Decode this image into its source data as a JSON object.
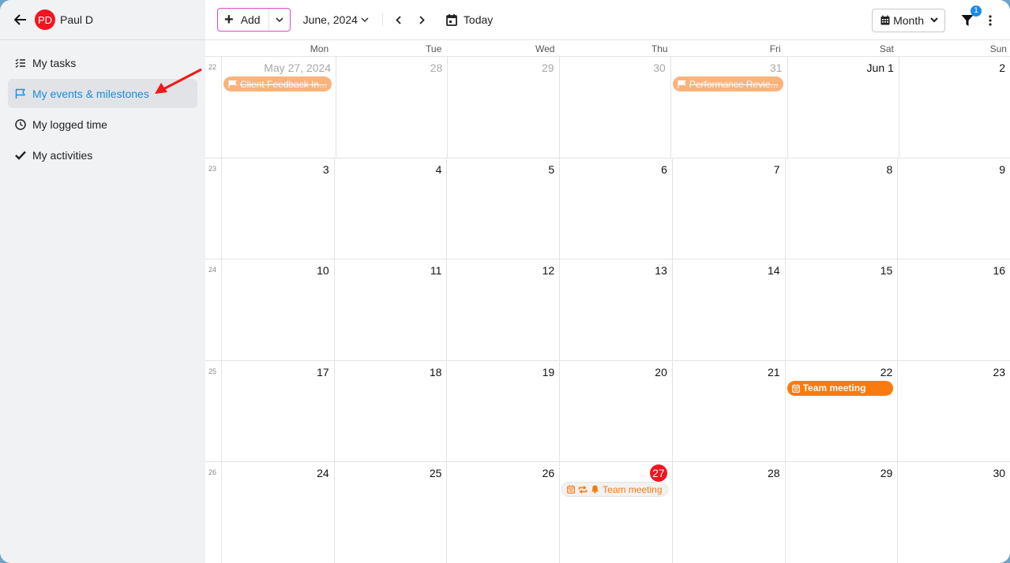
{
  "sidebar": {
    "user": {
      "initials": "PD",
      "name": "Paul D",
      "avatar_color": "#f5141f"
    },
    "items": [
      {
        "label": "My tasks",
        "icon": "checklist-icon",
        "active": false
      },
      {
        "label": "My events & milestones",
        "icon": "flag-icon",
        "active": true
      },
      {
        "label": "My logged time",
        "icon": "clock-icon",
        "active": false
      },
      {
        "label": "My activities",
        "icon": "check-icon",
        "active": false
      }
    ]
  },
  "toolbar": {
    "add_label": "Add",
    "period_label": "June, 2024",
    "today_label": "Today",
    "view_label": "Month",
    "filter_count": "1"
  },
  "calendar": {
    "days_of_week": [
      "Mon",
      "Tue",
      "Wed",
      "Thu",
      "Fri",
      "Sat",
      "Sun"
    ],
    "weeks": [
      {
        "number": "22",
        "days": [
          {
            "label": "May 27, 2024",
            "other": true,
            "events": [
              {
                "title": "Client Feedback In...",
                "style": "done",
                "icons": [
                  "flag-icon"
                ]
              }
            ]
          },
          {
            "label": "28",
            "other": true
          },
          {
            "label": "29",
            "other": true
          },
          {
            "label": "30",
            "other": true
          },
          {
            "label": "31",
            "other": true,
            "events": [
              {
                "title": "Performance Revie...",
                "style": "done",
                "icons": [
                  "flag-icon"
                ]
              }
            ]
          },
          {
            "label": "Jun 1"
          },
          {
            "label": "2"
          }
        ]
      },
      {
        "number": "23",
        "days": [
          {
            "label": "3"
          },
          {
            "label": "4"
          },
          {
            "label": "5"
          },
          {
            "label": "6"
          },
          {
            "label": "7"
          },
          {
            "label": "8"
          },
          {
            "label": "9"
          }
        ]
      },
      {
        "number": "24",
        "days": [
          {
            "label": "10"
          },
          {
            "label": "11"
          },
          {
            "label": "12"
          },
          {
            "label": "13"
          },
          {
            "label": "14"
          },
          {
            "label": "15"
          },
          {
            "label": "16"
          }
        ]
      },
      {
        "number": "25",
        "days": [
          {
            "label": "17"
          },
          {
            "label": "18"
          },
          {
            "label": "19"
          },
          {
            "label": "20"
          },
          {
            "label": "21"
          },
          {
            "label": "22",
            "events": [
              {
                "title": "Team meeting",
                "style": "solid",
                "icons": [
                  "calendar-icon"
                ]
              }
            ]
          },
          {
            "label": "23"
          }
        ]
      },
      {
        "number": "26",
        "days": [
          {
            "label": "24"
          },
          {
            "label": "25"
          },
          {
            "label": "26"
          },
          {
            "label": "27",
            "today": true,
            "events": [
              {
                "title": "Team meeting",
                "style": "light",
                "icons": [
                  "calendar-icon",
                  "repeat-icon",
                  "bell-icon"
                ]
              }
            ]
          },
          {
            "label": "28"
          },
          {
            "label": "29"
          },
          {
            "label": "30"
          }
        ]
      }
    ]
  },
  "colors": {
    "accent": "#1a8cdb",
    "today": "#f1131e",
    "event_orange": "#fb7a0e",
    "event_done": "#fbb27b",
    "add_border": "#d949c8"
  }
}
